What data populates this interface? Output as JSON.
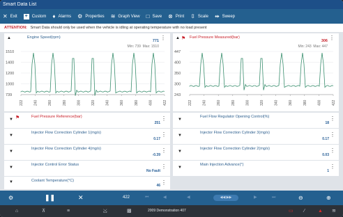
{
  "window": {
    "title": "Smart Data List"
  },
  "toolbar": {
    "items": [
      {
        "icon": "close-icon",
        "glyph": "✕",
        "label": "Exit"
      },
      {
        "icon": "custom-icon",
        "glyph": "+",
        "label": "Custom"
      },
      {
        "icon": "bell-icon",
        "glyph": "🔔",
        "label": "Alarms"
      },
      {
        "icon": "gear-icon",
        "glyph": "⚙",
        "label": "Properties"
      },
      {
        "icon": "graph-view-icon",
        "glyph": "≋",
        "label": "Graph View"
      },
      {
        "icon": "save-icon",
        "glyph": "⎙",
        "label": "Save"
      },
      {
        "icon": "print-icon",
        "glyph": "⎙",
        "label": "Print"
      },
      {
        "icon": "scale-icon",
        "glyph": "⇳",
        "label": "Scale"
      },
      {
        "icon": "sweep-icon",
        "glyph": "⇹",
        "label": "Sweep"
      }
    ]
  },
  "attention": {
    "label": "ATTENTION:",
    "text": "Smart Data should only be used when the vehicle is idling at operating temperature with no load present"
  },
  "graphs": [
    {
      "name": "Engine Speed(rpm)",
      "value": "771",
      "min_label": "Min: 739",
      "max_label": "Max: 1510",
      "y_ticks": [
        "1510",
        "1400",
        "1200",
        "1000",
        "739"
      ],
      "x_ticks": [
        "222",
        "240",
        "260",
        "280",
        "300",
        "320",
        "340",
        "360",
        "380",
        "400",
        "422"
      ],
      "flagged": false
    },
    {
      "name": "Fuel Pressure Measured(bar)",
      "value": "306",
      "min_label": "Min: 243",
      "max_label": "Max: 447",
      "y_ticks": [
        "447",
        "400",
        "350",
        "300",
        "243"
      ],
      "x_ticks": [
        "222",
        "240",
        "260",
        "280",
        "300",
        "320",
        "340",
        "360",
        "380",
        "400",
        "422"
      ],
      "flagged": true
    }
  ],
  "rows_left": [
    {
      "label": "Fuel Pressure Reference(bar)",
      "value": "251",
      "flagged": true
    },
    {
      "label": "Injector Flow Correction Cylinder 1(mg/s)",
      "value": "0.17",
      "flagged": false
    },
    {
      "label": "Injector Flow Correction Cylinder 4(mg/s)",
      "value": "-0.39",
      "flagged": false
    },
    {
      "label": "Injector Control Error Status",
      "value": "No Fault",
      "flagged": false
    },
    {
      "label": "Coolant Temperature(°C)",
      "value": "46",
      "flagged": false
    }
  ],
  "rows_right": [
    {
      "label": "Fuel Flow Regulator Opening Control(%)",
      "value": "18",
      "flagged": false
    },
    {
      "label": "Injector Flow Correction Cylinder 3(mg/s)",
      "value": "0.17",
      "flagged": false
    },
    {
      "label": "Injector Flow Correction Cylinder 2(mg/s)",
      "value": "0.03",
      "flagged": false
    },
    {
      "label": "Main Injection Advance(°)",
      "value": "1",
      "flagged": false
    }
  ],
  "playback": {
    "frame": "422",
    "pill_glyph": "◀◀ ▶▶"
  },
  "bottom": {
    "title": "2009 Demonstration 407"
  },
  "colors": {
    "accent": "#24608f",
    "title_bar": "#1d4f88",
    "flag": "#c8202a",
    "value_blue": "#245c95"
  }
}
